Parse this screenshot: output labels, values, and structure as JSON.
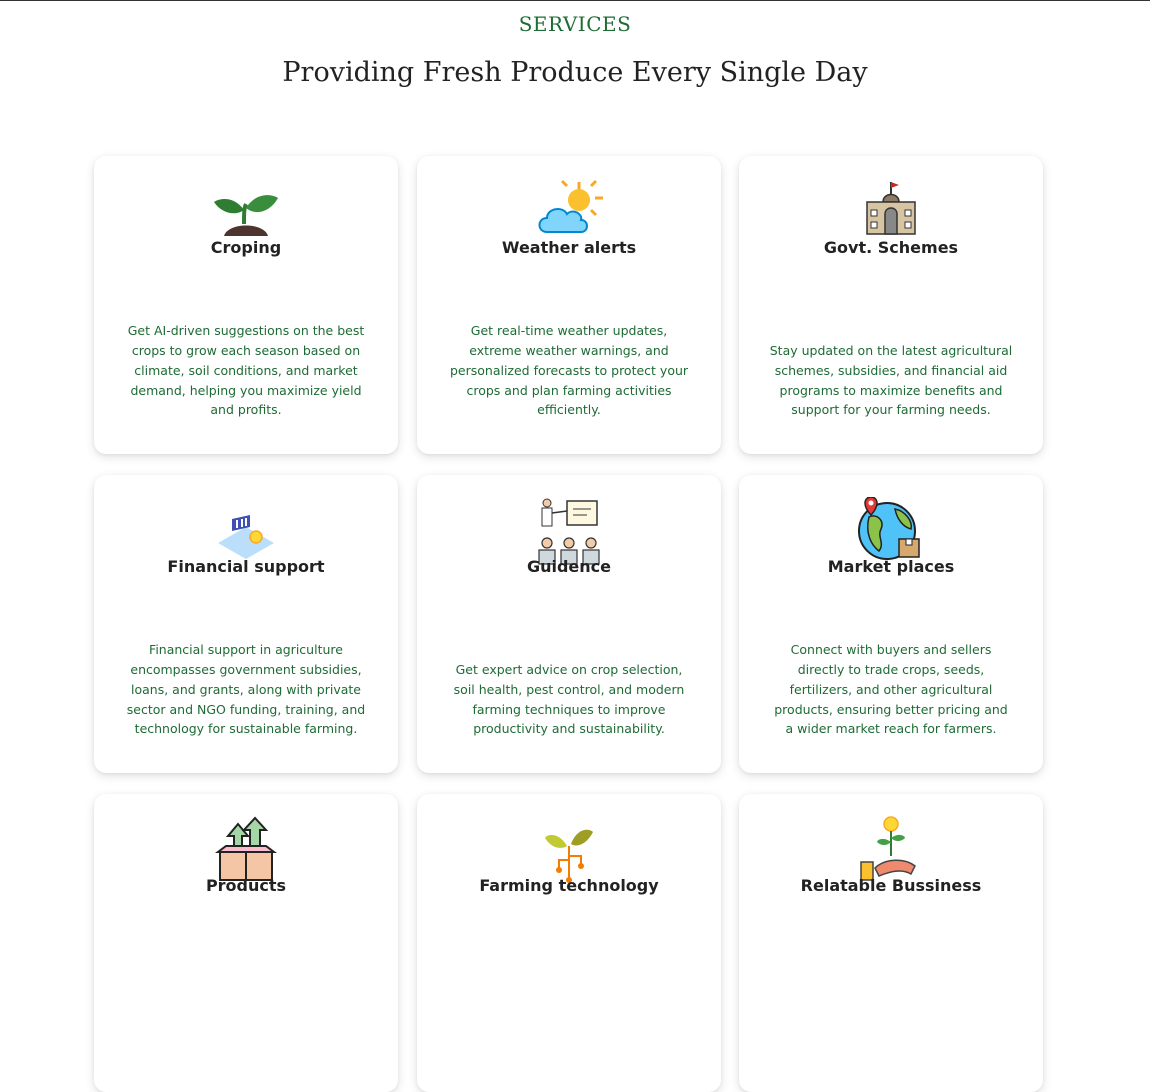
{
  "section": {
    "kicker": "SERVICES",
    "heading": "Providing Fresh Produce Every Single Day"
  },
  "cards": [
    {
      "title": "Croping",
      "icon": "sprout-icon",
      "desc": "Get AI-driven suggestions on the best crops to grow each season based on climate, soil conditions, and market demand, helping you maximize yield and profits."
    },
    {
      "title": "Weather alerts",
      "icon": "weather-icon",
      "desc": "Get real-time weather updates, extreme weather warnings, and personalized forecasts to protect your crops and plan farming activities efficiently."
    },
    {
      "title": "Govt. Schemes",
      "icon": "government-building-icon",
      "desc": "Stay updated on the latest agricultural schemes, subsidies, and financial aid programs to maximize benefits and support for your farming needs."
    },
    {
      "title": "Financial support",
      "icon": "bank-coin-icon",
      "desc": "Financial support in agriculture encompasses government subsidies, loans, and grants, along with private sector and NGO funding, training, and technology for sustainable farming."
    },
    {
      "title": "Guidence",
      "icon": "presentation-icon",
      "desc": "Get expert advice on crop selection, soil health, pest control, and modern farming techniques to improve productivity and sustainability."
    },
    {
      "title": "Market places",
      "icon": "globe-location-icon",
      "desc": "Connect with buyers and sellers directly to trade crops, seeds, fertilizers, and other agricultural products, ensuring better pricing and a wider market reach for farmers."
    },
    {
      "title": "Products",
      "icon": "box-growth-icon",
      "desc": ""
    },
    {
      "title": "Farming technology",
      "icon": "sprout-circuit-icon",
      "desc": ""
    },
    {
      "title": "Relatable Bussiness",
      "icon": "hand-money-plant-icon",
      "desc": ""
    }
  ]
}
